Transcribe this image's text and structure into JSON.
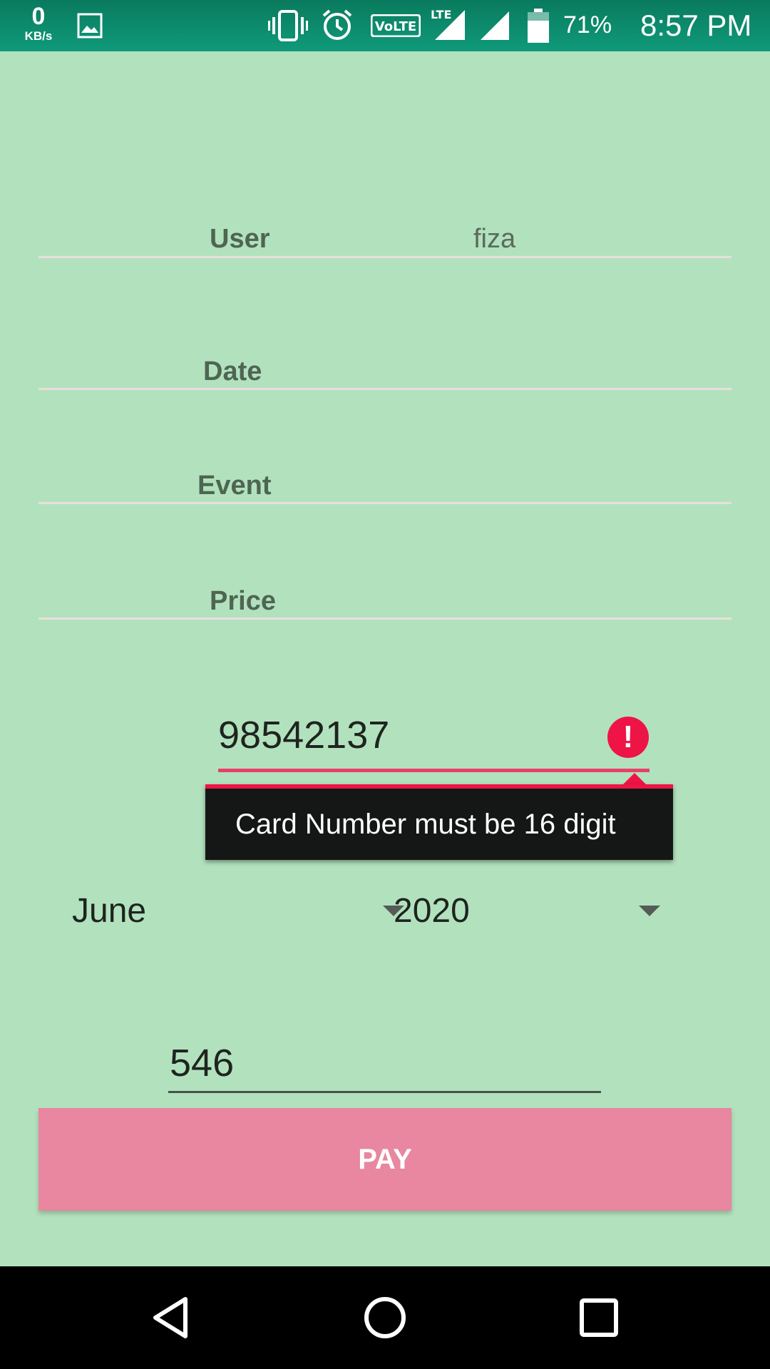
{
  "status_bar": {
    "net_speed_value": "0",
    "net_speed_unit": "KB/s",
    "icons": [
      "image-icon",
      "vibrate-icon",
      "alarm-icon",
      "volte-icon",
      "lte-signal-icon",
      "signal-icon",
      "battery-icon"
    ],
    "volte_label": "VoLTE",
    "lte_label": "LTE",
    "battery_percent": "71%",
    "time": "8:57 PM"
  },
  "form": {
    "user_label": "User",
    "user_value": "fiza",
    "date_label": "Date",
    "event_label": "Event",
    "price_label": "Price",
    "card_number_value": "98542137",
    "card_error": "Card Number must be 16 digit",
    "month_selected": "June",
    "year_selected": "2020",
    "cvv_value": "546",
    "pay_label": "PAY"
  },
  "colors": {
    "background": "#b2e2bd",
    "error": "#ef1446",
    "pay_button": "#e8879f"
  }
}
